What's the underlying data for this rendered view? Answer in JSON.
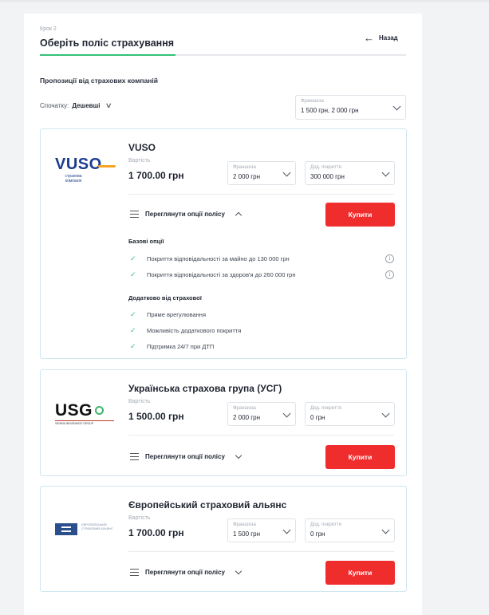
{
  "header": {
    "step": "Крок 2",
    "title": "Оберіть поліс страхування",
    "back_label": "Назад",
    "progress_fraction": 0.37
  },
  "offers_title": "Пропозиції від страхових компаній",
  "sort": {
    "label": "Спочатку:",
    "value": "Дешевші"
  },
  "franchise_filter": {
    "caption": "Франшиза",
    "value": "1 500 грн, 2 000 грн"
  },
  "common": {
    "price_caption": "Вартість",
    "franchise_caption": "Франшиза",
    "coverage_caption": "Дод. покриття",
    "toggle_label": "Переглянути опції полісу",
    "buy_label": "Купити"
  },
  "offers": [
    {
      "company": "VUSO",
      "logo_text": "VUSO",
      "logo_sub": "страхова компанія",
      "price": "1 700.00 грн",
      "franchise": "2 000 грн",
      "coverage": "300 000 грн",
      "expanded": true,
      "base_options_title": "Базові опції",
      "base_options": [
        "Покриття відповідальності за майно до 130 000 грн",
        "Покриття відповідальності за здоров'я до 260 000 грн"
      ],
      "extra_options_title": "Додатково від страхової",
      "extra_options": [
        "Пряме врегулювання",
        "Можливість додаткового покриття",
        "Підтримка 24/7 при ДТП"
      ]
    },
    {
      "company": "Українська страхова група (УСГ)",
      "logo_text": "USG",
      "logo_sub": "VIENNA INSURANCE GROUP",
      "price": "1 500.00 грн",
      "franchise": "2 000 грн",
      "coverage": "0 грн",
      "expanded": false
    },
    {
      "company": "Європейський страховий альянс",
      "logo_text": "ЄВРОПЕЙСЬКИЙ СТРАХОВИЙ АЛЬЯНС",
      "price": "1 700.00 грн",
      "franchise": "1 500 грн",
      "coverage": "0 грн",
      "expanded": false
    }
  ],
  "colors": {
    "accent_green": "#34c178",
    "buy_red": "#f02d2d",
    "card_border": "#cfe6f1",
    "vuso_blue": "#1b3d8f",
    "vuso_orange": "#f5a623"
  }
}
